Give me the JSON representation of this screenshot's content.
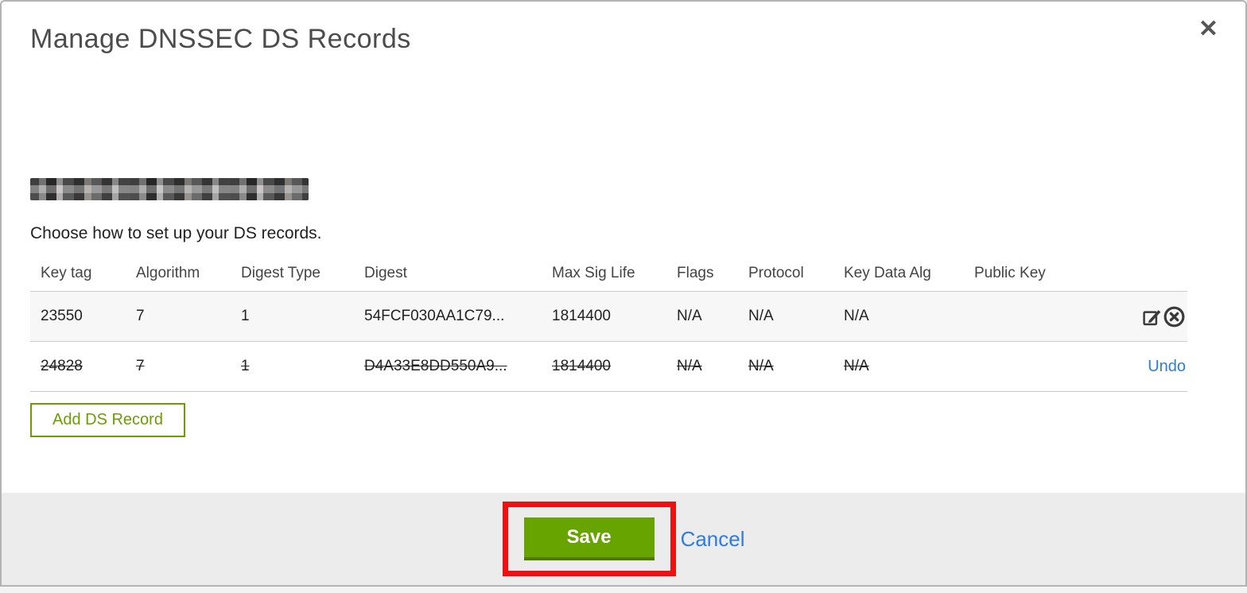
{
  "modal": {
    "title": "Manage DNSSEC DS Records",
    "subtitle": "Choose how to set up your DS records.",
    "domain_redacted": true
  },
  "icons": {
    "close": "✕",
    "edit": "pencil-square-icon",
    "delete": "circle-x-icon"
  },
  "table": {
    "headers": [
      "Key tag",
      "Algorithm",
      "Digest Type",
      "Digest",
      "Max Sig Life",
      "Flags",
      "Protocol",
      "Key Data Alg",
      "Public Key"
    ],
    "rows": [
      {
        "key_tag": "23550",
        "algorithm": "7",
        "digest_type": "1",
        "digest": "54FCF030AA1C79...",
        "max_sig_life": "1814400",
        "flags": "N/A",
        "protocol": "N/A",
        "key_data_alg": "N/A",
        "public_key": "",
        "status": "active"
      },
      {
        "key_tag": "24828",
        "algorithm": "7",
        "digest_type": "1",
        "digest": "D4A33E8DD550A9...",
        "max_sig_life": "1814400",
        "flags": "N/A",
        "protocol": "N/A",
        "key_data_alg": "N/A",
        "public_key": "",
        "status": "marked-for-deletion",
        "action_label": "Undo"
      }
    ]
  },
  "actions": {
    "add_ds_record": "Add DS Record",
    "save": "Save",
    "cancel": "Cancel"
  },
  "colors": {
    "save_green": "#68a400",
    "save_green_dark": "#4e7c00",
    "add_border_green": "#6a9e00",
    "link_blue": "#2e7ce0",
    "annotation_red": "#ee1111",
    "footer_bg": "#ececec",
    "row_stripe": "#f7f7f7",
    "table_border": "#c9c9c9"
  }
}
